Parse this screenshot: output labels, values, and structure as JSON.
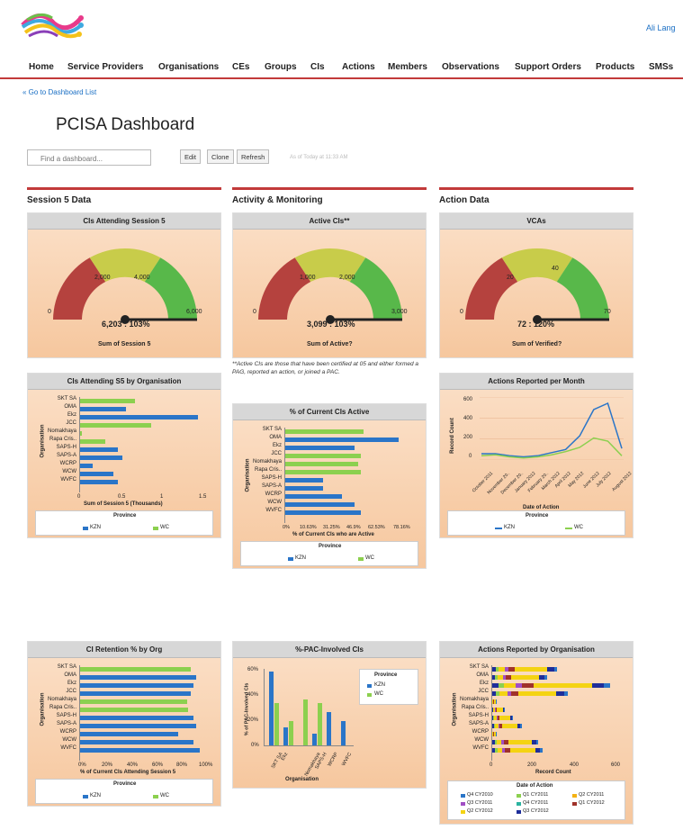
{
  "header": {
    "user_link": "Ali Lang"
  },
  "nav": [
    "Home",
    "Service Providers",
    "Organisations",
    "CEs",
    "Groups",
    "CIs",
    "Actions",
    "Members",
    "Observations",
    "Support Orders",
    "Products",
    "SMSs"
  ],
  "breadcrumb": "« Go to Dashboard List",
  "page_title": "PCISA Dashboard",
  "find": {
    "placeholder": "Find a dashboard..."
  },
  "toolbar": {
    "edit": "Edit",
    "clone": "Clone",
    "refresh": "Refresh",
    "updated": "As of Today at 11:33 AM"
  },
  "columns": [
    "Session 5 Data",
    "Activity & Monitoring",
    "Action Data"
  ],
  "orgs": [
    "SKT SA",
    "OMA",
    "Ekz",
    "JCC",
    "Nomakhaya",
    "Rapa Cris..",
    "SAPS-H",
    "SAPS-A",
    "WCRP",
    "WCW",
    "WVFC"
  ],
  "gauges": [
    {
      "title": "CIs Attending Session 5",
      "ticks": [
        "0",
        "2,000",
        "4,000",
        "6,000"
      ],
      "value": "6,203 : 103%",
      "footer": "Sum of Session 5"
    },
    {
      "title": "Active CIs**",
      "ticks": [
        "0",
        "1,000",
        "2,000",
        "3,000"
      ],
      "value": "3,099 : 103%",
      "footer": "Sum of Active?"
    },
    {
      "title": "VCAs",
      "ticks": [
        "0",
        "20",
        "40",
        "70"
      ],
      "value": "72 : 120%",
      "footer": "Sum of Verified?"
    }
  ],
  "note": "**Active CIs are those that have been certified at 05 and either formed a PAG, reported an action, or joined a PAC.",
  "charts": {
    "att_by_org": {
      "title": "CIs Attending S5 by Organisation",
      "ylabel": "Organisation",
      "xlabel": "Sum of Session 5 (Thousands)",
      "xticks": [
        "0",
        "0.5",
        "1",
        "1.5"
      ],
      "legend_title": "Province",
      "legend": [
        "KZN",
        "WC"
      ]
    },
    "pct_active": {
      "title": "% of Current CIs Active",
      "ylabel": "Organisation",
      "xlabel": "% of Current CIs who are Active",
      "xticks": [
        "0%",
        "10.63%",
        "31.25%",
        "46.9%",
        "62.53%",
        "78.16%"
      ],
      "legend_title": "Province",
      "legend": [
        "KZN",
        "WC"
      ]
    },
    "actions_month": {
      "title": "Actions Reported per Month",
      "ylabel": "Record Count",
      "xlabel": "Date of Action",
      "yticks": [
        "0",
        "200",
        "400",
        "600"
      ],
      "months": [
        "October 2011",
        "November 20..",
        "December 20..",
        "January 2012",
        "February 20..",
        "March 2012",
        "April 2012",
        "May 2012",
        "June 2012",
        "July 2012",
        "August 2012"
      ],
      "legend_title": "Province",
      "legend": [
        "KZN",
        "WC"
      ]
    },
    "retention": {
      "title": "CI Retention % by Org",
      "ylabel": "Organisation",
      "xlabel": "% of Current CIs Attending Session 5",
      "xticks": [
        "0%",
        "20%",
        "40%",
        "60%",
        "80%",
        "100%"
      ],
      "legend_title": "Province",
      "legend": [
        "KZN",
        "WC"
      ]
    },
    "pac": {
      "title": "%-PAC-Involved CIs",
      "ylabel": "% of PAC-Involved CIs",
      "xlabel": "Organisation",
      "yticks": [
        "0%",
        "20%",
        "40%",
        "60%"
      ],
      "xcats": [
        "SKT SA",
        "Ekz",
        "Nomakhaya",
        "SAPS-H",
        "WCRP",
        "WVFC"
      ],
      "legend_title": "Province",
      "legend": [
        "KZN",
        "WC"
      ]
    },
    "actions_org": {
      "title": "Actions Reported by Organisation",
      "ylabel": "Organisation",
      "xlabel": "Record Count",
      "xticks": [
        "0",
        "200",
        "400",
        "600"
      ],
      "legend_title": "Date of Action",
      "legend": [
        "Q4 CY2010",
        "Q1 CY2011",
        "Q2 CY2011",
        "Q3 CY2011",
        "Q4 CY2011",
        "Q1 CY2012",
        "Q2 CY2012",
        "Q3 CY2012"
      ]
    }
  },
  "chart_data": [
    {
      "type": "bar",
      "title": "CIs Attending S5 by Organisation",
      "categories": [
        "SKT SA",
        "OMA",
        "Ekz",
        "JCC",
        "Nomakhaya",
        "Rapa Cris..",
        "SAPS-H",
        "SAPS-A",
        "WCRP",
        "WCW",
        "WVFC"
      ],
      "values": [
        0.65,
        0.55,
        1.4,
        0.85,
        0.02,
        0.3,
        0.45,
        0.5,
        0.15,
        0.4,
        0.45
      ],
      "xlabel": "Sum of Session 5 (Thousands)",
      "ylabel": "Organisation",
      "xlim": [
        0,
        1.5
      ]
    },
    {
      "type": "bar",
      "title": "% of Current CIs Active",
      "categories": [
        "SKT SA",
        "OMA",
        "Ekz",
        "JCC",
        "Nomakhaya",
        "Rapa Cris..",
        "SAPS-H",
        "SAPS-A",
        "WCRP",
        "WCW",
        "WVFC"
      ],
      "values": [
        62,
        90,
        55,
        60,
        58,
        60,
        30,
        30,
        45,
        55,
        60
      ],
      "xlabel": "% of Current CIs who are Active",
      "ylabel": "Organisation"
    },
    {
      "type": "line",
      "title": "Actions Reported per Month",
      "x": [
        "October 2011",
        "November 20..",
        "December 20..",
        "January 2012",
        "February 20..",
        "March 2012",
        "April 2012",
        "May 2012",
        "June 2012",
        "July 2012",
        "August 2012"
      ],
      "series": [
        {
          "name": "KZN",
          "values": [
            60,
            60,
            40,
            30,
            40,
            70,
            100,
            230,
            480,
            540,
            110
          ]
        },
        {
          "name": "WC",
          "values": [
            40,
            50,
            30,
            20,
            30,
            50,
            80,
            120,
            210,
            180,
            40
          ]
        }
      ],
      "xlabel": "Date of Action",
      "ylabel": "Record Count",
      "ylim": [
        0,
        600
      ]
    },
    {
      "type": "bar",
      "title": "CI Retention % by Org",
      "categories": [
        "SKT SA",
        "OMA",
        "Ekz",
        "JCC",
        "Nomakhaya",
        "Rapa Cris..",
        "SAPS-H",
        "SAPS-A",
        "WCRP",
        "WCW",
        "WVFC"
      ],
      "values": [
        88,
        92,
        90,
        88,
        85,
        86,
        90,
        92,
        78,
        90,
        95
      ],
      "xlabel": "% of Current CIs Attending Session 5",
      "ylabel": "Organisation",
      "xlim": [
        0,
        100
      ]
    },
    {
      "type": "bar",
      "title": "%-PAC-Involved CIs",
      "categories": [
        "SKT SA",
        "Ekz",
        "Nomakhaya",
        "SAPS-H",
        "WCRP",
        "WVFC"
      ],
      "series": [
        {
          "name": "KZN",
          "values": [
            62,
            15,
            0,
            10,
            28,
            20
          ]
        },
        {
          "name": "WC",
          "values": [
            35,
            20,
            38,
            35,
            0,
            0
          ]
        }
      ],
      "xlabel": "Organisation",
      "ylabel": "% of PAC-Involved CIs",
      "ylim": [
        0,
        60
      ]
    },
    {
      "type": "bar",
      "title": "Actions Reported by Organisation",
      "categories": [
        "SKT SA",
        "OMA",
        "Ekz",
        "JCC",
        "Nomakhaya",
        "Rapa Cris..",
        "SAPS-H",
        "SAPS-A",
        "WCRP",
        "WCW",
        "WVFC"
      ],
      "values": [
        310,
        260,
        560,
        360,
        20,
        60,
        100,
        140,
        20,
        220,
        240
      ],
      "xlabel": "Record Count",
      "ylabel": "Organisation",
      "xlim": [
        0,
        600
      ]
    }
  ]
}
